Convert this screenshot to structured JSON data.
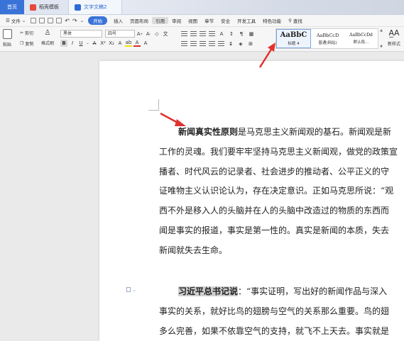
{
  "tabs": {
    "home": "首页",
    "template": "稻壳模板",
    "document": "文字文稿2"
  },
  "menu": {
    "file": "文件",
    "start": "开始",
    "items": [
      "插入",
      "页面布局",
      "引用",
      "审阅",
      "视图",
      "章节",
      "安全",
      "开发工具",
      "特色功能"
    ],
    "search": "查找",
    "selected_item": "引用"
  },
  "ribbon": {
    "paste": "粘贴",
    "cut": "剪切",
    "copy": "复制",
    "format_painter": "格式刷",
    "font_name": "黑体",
    "font_size": "四号",
    "styles": [
      {
        "preview": "AaBbC",
        "label": "标题 4"
      },
      {
        "preview": "AaBbCcD",
        "label": "普通(网站)"
      },
      {
        "preview": "AaBbCcDd",
        "label": "默认段..."
      }
    ],
    "new_style": "新样式"
  },
  "document": {
    "para1": {
      "lead": "新闻真实性原则",
      "lines": [
        "是马克思主义新闻观的基石。新闻观是新",
        "工作的灵魂。我们要牢牢坚持马克思主义新闻观，做党的政策宣",
        "播者、时代风云的记录者、社会进步的推动者、公平正义的守",
        "证唯物主义认识论认为，存在决定意识。正如马克思所说：“观",
        "西不外是移入人的头脑并在人的头脑中改造过的物质的东西而",
        "闻是事实的报道，事实是第一性的。真实是新闻的本质，失去",
        "新闻就失去生命。"
      ]
    },
    "para2": {
      "lead": "习近平总书记说",
      "lead_colon": "：",
      "lines": [
        "“事实证明，写出好的新闻作品与深入",
        "事实的关系，就好比鸟的翅膀与空气的关系那么重要。鸟的翅",
        "多么完善，如果不依靠空气的支持，就飞不上天去。事实就是"
      ]
    }
  },
  "colors": {
    "accent": "#3a73d8",
    "arrow": "#e0312f"
  }
}
